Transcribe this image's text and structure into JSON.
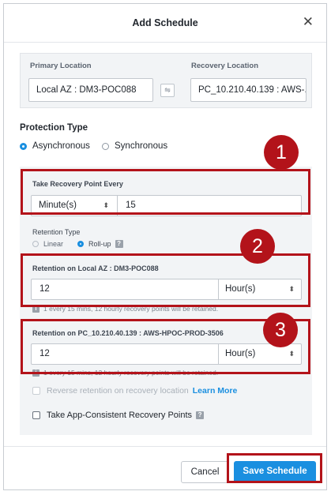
{
  "dialog": {
    "title": "Add Schedule",
    "close_glyph": "✕"
  },
  "locations": {
    "primary_label": "Primary Location",
    "primary_value": "Local AZ : DM3-POC088",
    "recovery_label": "Recovery Location",
    "recovery_value": "PC_10.210.40.139 : AWS-...",
    "swap_glyph": "⇋"
  },
  "protection": {
    "title": "Protection Type",
    "options": [
      {
        "label": "Asynchronous",
        "selected": true
      },
      {
        "label": "Synchronous",
        "selected": false
      }
    ]
  },
  "recovery_point": {
    "label": "Take Recovery Point Every",
    "unit": "Minute(s)",
    "value": "15"
  },
  "retention_type": {
    "label": "Retention Type",
    "options": [
      {
        "label": "Linear",
        "selected": false
      },
      {
        "label": "Roll-up",
        "selected": true
      }
    ],
    "help_glyph": "?"
  },
  "retention_local": {
    "label": "Retention on Local AZ : DM3-POC088",
    "value": "12",
    "unit": "Hour(s)",
    "note": "1 every 15 mins, 12 hourly recovery points will be retained."
  },
  "retention_remote": {
    "label": "Retention on PC_10.210.40.139 : AWS-HPOC-PROD-3506",
    "value": "12",
    "unit": "Hour(s)",
    "note": "1 every 15 mins, 12 hourly recovery points will be retained."
  },
  "reverse_retention": {
    "label": "Reverse retention on recovery location",
    "link": "Learn More",
    "enabled": false
  },
  "app_consistent": {
    "label": "Take App-Consistent Recovery Points",
    "checked": false,
    "help_glyph": "?"
  },
  "buttons": {
    "cancel": "Cancel",
    "save": "Save Schedule"
  },
  "annotations": {
    "badge_1": "1",
    "badge_2": "2",
    "badge_3": "3"
  },
  "colors": {
    "accent": "#1a8fe0",
    "annotation_red": "#b3131a",
    "panel_bg": "#f2f4f6"
  }
}
